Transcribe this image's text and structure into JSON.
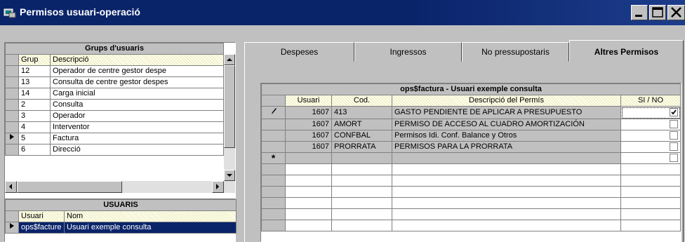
{
  "window": {
    "title": "Permisos usuari-operació"
  },
  "groups": {
    "caption": "Grups d'usuaris",
    "columns": [
      "Grup",
      "Descripció"
    ],
    "rows": [
      {
        "grup": "12",
        "desc": "Operador de centre gestor despe"
      },
      {
        "grup": "13",
        "desc": "Consulta de centre gestor despes"
      },
      {
        "grup": "14",
        "desc": "Carga inicial"
      },
      {
        "grup": "2",
        "desc": "Consulta"
      },
      {
        "grup": "3",
        "desc": "Operador"
      },
      {
        "grup": "4",
        "desc": "Interventor"
      },
      {
        "grup": "5",
        "desc": "Factura"
      },
      {
        "grup": "6",
        "desc": "Direcció"
      }
    ],
    "current_row_index": 6
  },
  "users": {
    "caption": "USUARIS",
    "columns": [
      "Usuari",
      "Nom"
    ],
    "rows": [
      {
        "usuari": "ops$facture",
        "nom": "Usuari exemple consulta"
      }
    ]
  },
  "tabs": [
    "Despeses",
    "Ingressos",
    "No pressupostaris",
    "Altres Permisos"
  ],
  "active_tab": "Altres Permisos",
  "permissions": {
    "caption": "ops$factura - Usuari exemple consulta",
    "columns": [
      "Usuari",
      "Cod.",
      "Descripció del Permís",
      "SI / NO"
    ],
    "rows": [
      {
        "usuari": "1607",
        "cod": "413",
        "desc": "GASTO PENDIENTE DE APLICAR A PRESUPUESTO",
        "checked": true
      },
      {
        "usuari": "1607",
        "cod": "AMORT",
        "desc": "PERMISO DE ACCESO AL CUADRO AMORTIZACIÓN",
        "checked": false
      },
      {
        "usuari": "1607",
        "cod": "CONFBAL",
        "desc": "Permisos Idi. Conf. Balance y Otros",
        "checked": false
      },
      {
        "usuari": "1607",
        "cod": "PRORRATA",
        "desc": "PERMISOS PARA LA PRORRATA",
        "checked": false
      }
    ],
    "new_row_marker": "*"
  }
}
